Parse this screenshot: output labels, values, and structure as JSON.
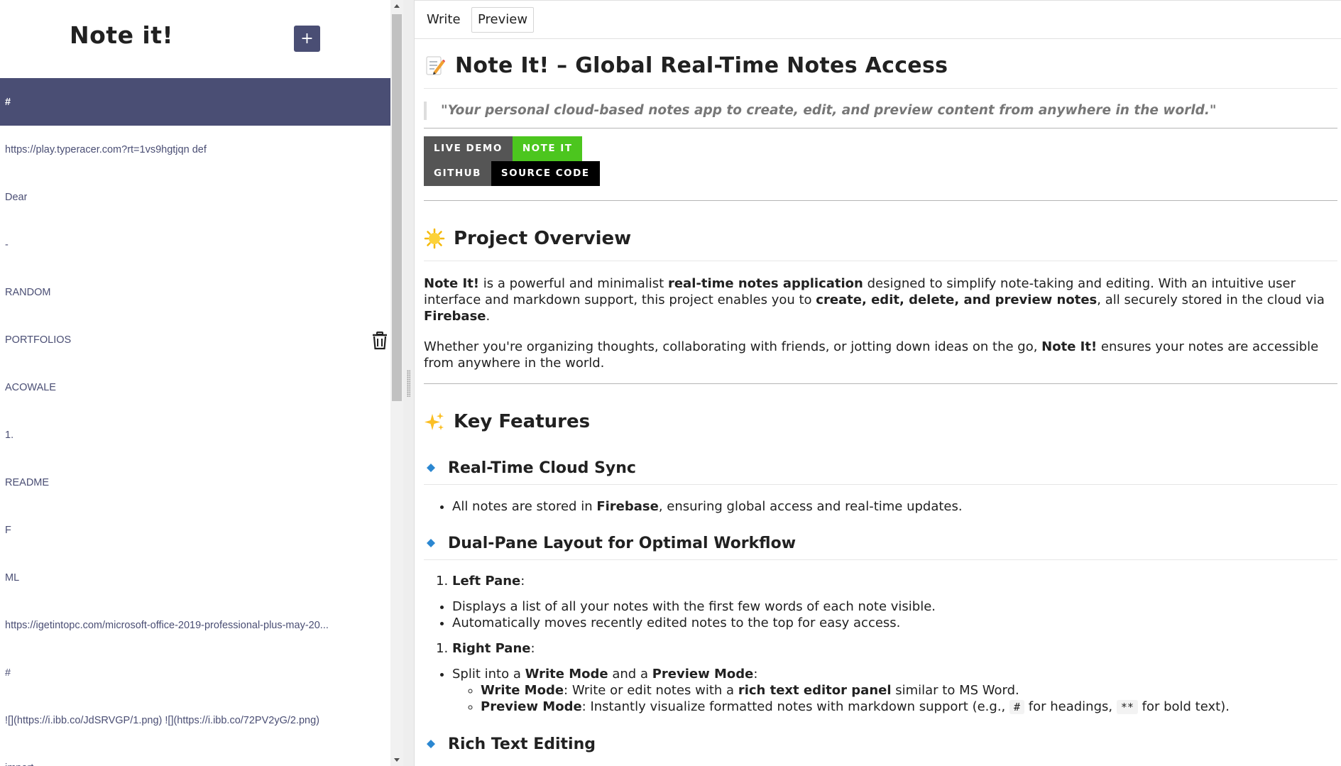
{
  "app": {
    "title": "Note it!",
    "new_note_label": "+"
  },
  "notes": [
    "#",
    "https://play.typeracer.com?rt=1vs9hgtjqn def",
    "Dear",
    "-",
    "RANDOM",
    "PORTFOLIOS",
    "ACOWALE",
    "1.",
    "README",
    "F",
    "ML",
    "https://igetintopc.com/microsoft-office-2019-professional-plus-may-20...",
    "#",
    "![](https://i.ibb.co/JdSRVGP/1.png) ![](https://i.ibb.co/72PV2yG/2.png)",
    "import"
  ],
  "selected_note_index": 0,
  "hovered_note_index": 5,
  "tabs": {
    "write": "Write",
    "preview": "Preview"
  },
  "doc": {
    "title_emoji": "memo-icon",
    "title": "Note It! – Global Real-Time Notes Access",
    "quote": "\"Your personal cloud-based notes app to create, edit, and preview content from anywhere in the world.\"",
    "badges": [
      {
        "label": "LIVE DEMO",
        "value": "NOTE IT",
        "label_color": "#555555",
        "value_color": "#4cc61e"
      },
      {
        "label": "GITHUB",
        "value": "SOURCE CODE",
        "label_color": "#555555",
        "value_color": "#000000"
      }
    ],
    "overview": {
      "heading": "Project Overview",
      "p1": {
        "s1": "Note It!",
        "t1": " is a powerful and minimalist ",
        "s2": "real-time notes application",
        "t2": " designed to simplify note-taking and editing. With an intuitive user interface and markdown support, this project enables you to ",
        "s3": "create, edit, delete, and preview notes",
        "t3": ", all securely stored in the cloud via ",
        "s4": "Firebase",
        "t4": "."
      },
      "p2": {
        "t1": "Whether you're organizing thoughts, collaborating with friends, or jotting down ideas on the go, ",
        "s1": "Note It!",
        "t2": " ensures your notes are accessible from anywhere in the world."
      }
    },
    "features": {
      "heading": "Key Features",
      "sync": {
        "heading": "Real-Time Cloud Sync",
        "b1_t1": "All notes are stored in ",
        "b1_s1": "Firebase",
        "b1_t2": ", ensuring global access and real-time updates."
      },
      "layout": {
        "heading": "Dual-Pane Layout for Optimal Workflow",
        "left_pane": "Left Pane",
        "colon": ":",
        "left_b1": "Displays a list of all your notes with the first few words of each note visible.",
        "left_b2": "Automatically moves recently edited notes to the top for easy access.",
        "right_pane": "Right Pane",
        "right_b1_t1": "Split into a ",
        "right_b1_s1": "Write Mode",
        "right_b1_t2": " and a ",
        "right_b1_s2": "Preview Mode",
        "right_b1_t3": ":",
        "write_mode": "Write Mode",
        "write_mode_t1": ": Write or edit notes with a ",
        "write_mode_s1": "rich text editor panel",
        "write_mode_t2": " similar to MS Word.",
        "preview_mode": "Preview Mode",
        "preview_mode_t1": ": Instantly visualize formatted notes with markdown support (e.g., ",
        "code1": "#",
        "preview_mode_t2": " for headings, ",
        "code2": "**",
        "preview_mode_t3": " for bold text)."
      },
      "rich": {
        "heading": "Rich Text Editing"
      }
    }
  }
}
